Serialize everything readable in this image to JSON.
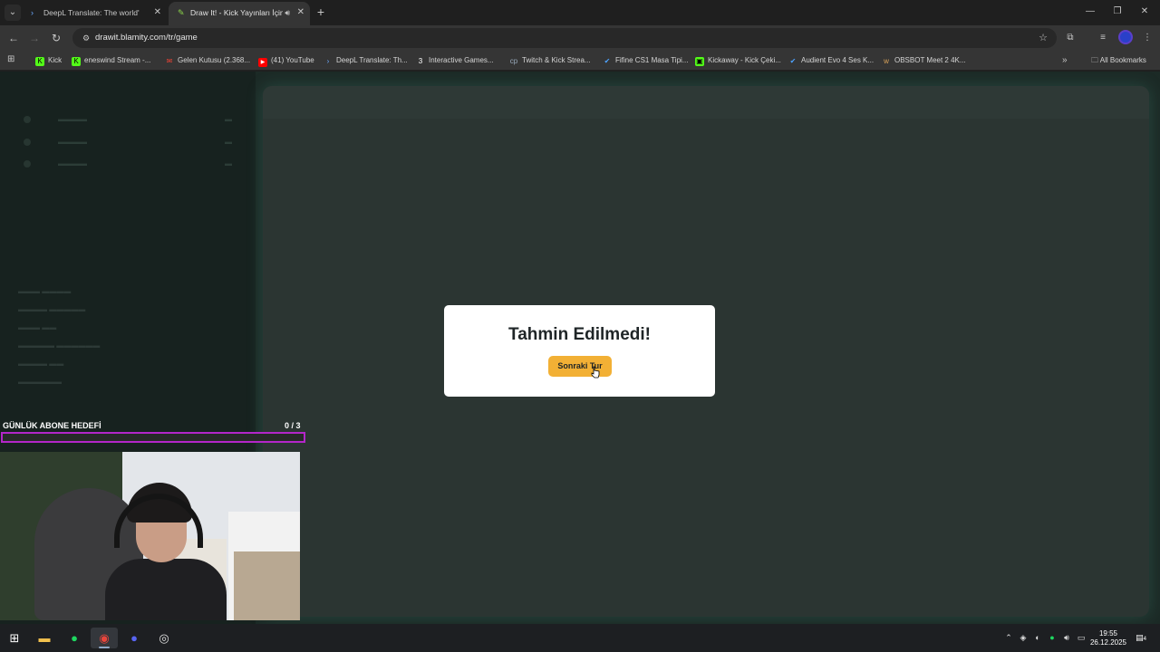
{
  "browser": {
    "tabs": [
      {
        "title": "DeepL Translate: The world's m",
        "favicon": "deepl-icon"
      },
      {
        "title": "Draw It! - Kick Yayınları İçin",
        "favicon": "drawit-icon",
        "active": true
      }
    ],
    "url": "drawit.blamity.com/tr/game",
    "bookmarks": [
      {
        "label": "Kick",
        "icon": "kick-icon"
      },
      {
        "label": "eneswind Stream -...",
        "icon": "kick-icon"
      },
      {
        "label": "Gelen Kutusu (2.368...",
        "icon": "gmail-icon"
      },
      {
        "label": "(41) YouTube",
        "icon": "youtube-icon"
      },
      {
        "label": "DeepL Translate: Th...",
        "icon": "deepl-icon"
      },
      {
        "label": "Interactive Games...",
        "icon": "games-icon"
      },
      {
        "label": "Twitch & Kick Strea...",
        "icon": "cp-icon"
      },
      {
        "label": "Fifine CS1 Masa Tipi...",
        "icon": "check-icon"
      },
      {
        "label": "Kickaway - Kick Çeki...",
        "icon": "kickaway-icon"
      },
      {
        "label": "Audient Evo 4 Ses K...",
        "icon": "check-icon"
      },
      {
        "label": "OBSBOT Meet 2 4K...",
        "icon": "obsbot-icon"
      }
    ],
    "all_bookmarks": "All Bookmarks"
  },
  "overlay": {
    "goal_label": "GÜNLÜK ABONE HEDEFİ",
    "goal_count": "0  / 3",
    "goal_progress": 0
  },
  "modal": {
    "title": "Tahmin Edilmedi!",
    "button_label": "Sonraki Tur"
  },
  "taskbar": {
    "time": "19:55",
    "date": "26.12.2025",
    "notifications": "4"
  },
  "colors": {
    "accent_button": "#f2b035",
    "progress_border": "#b326c9",
    "page_bg": "#1c2a26"
  }
}
